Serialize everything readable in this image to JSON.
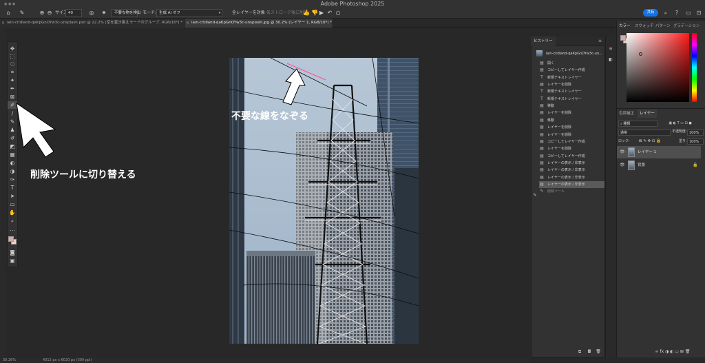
{
  "app": {
    "title": "Adobe Photoshop 2025"
  },
  "options_bar": {
    "size_label": "サイズ:",
    "size_value": "40",
    "detect_button": "不要な物を検出",
    "mode_label": "モード:",
    "mode_value": "生成 AI オフ",
    "all_layers_label": "全レイヤーを対象",
    "stroke_label": "各ストローク後に削除",
    "share_label": "共有"
  },
  "tabs": [
    {
      "label": "iain-cridland-qaKpGnOYw3c-unsplash.psd @ 22.2% (空を置き換えモードのグループ, RGB/16*) *"
    },
    {
      "label": "iain-cridland-qaKpGnOYw3c-unsplash.jpg @ 30.2% (レイヤー 1, RGB/16*) *"
    }
  ],
  "annotations": {
    "arrow_top_text": "不要な線をなぞる",
    "arrow_left_text": "削除ツールに切り替える"
  },
  "history": {
    "tab_label": "ヒストリー",
    "snapshot": "iain-cridland-qaKpGnOYw3c-un...",
    "items": [
      {
        "label": "開く",
        "icon": "doc-icon"
      },
      {
        "label": "コピーしてレイヤー作成",
        "icon": "doc-icon"
      },
      {
        "label": "新規テキストレイヤー",
        "icon": "text-icon"
      },
      {
        "label": "レイヤーを削除",
        "icon": "doc-icon"
      },
      {
        "label": "新規テキストレイヤー",
        "icon": "text-icon"
      },
      {
        "label": "新規テキストレイヤー",
        "icon": "text-icon"
      },
      {
        "label": "移動",
        "icon": "doc-icon"
      },
      {
        "label": "レイヤーを削除",
        "icon": "doc-icon"
      },
      {
        "label": "移動",
        "icon": "doc-icon"
      },
      {
        "label": "レイヤーを削除",
        "icon": "doc-icon"
      },
      {
        "label": "レイヤーを削除",
        "icon": "doc-icon"
      },
      {
        "label": "コピーしてレイヤー作成",
        "icon": "doc-icon"
      },
      {
        "label": "レイヤーを削除",
        "icon": "doc-icon"
      },
      {
        "label": "コピーしてレイヤー作成",
        "icon": "doc-icon"
      },
      {
        "label": "レイヤーの表示 / 非表示",
        "icon": "doc-icon"
      },
      {
        "label": "レイヤーの表示 / 非表示",
        "icon": "doc-icon"
      },
      {
        "label": "レイヤーの表示 / 非表示",
        "icon": "doc-icon"
      },
      {
        "label": "レイヤーの表示 / 非表示",
        "icon": "doc-icon"
      },
      {
        "label": "削除ツール",
        "icon": "brush-icon"
      }
    ]
  },
  "color_panel": {
    "tabs": [
      "カラー",
      "スウォッチ",
      "パターン",
      "グラデーション"
    ]
  },
  "layers_panel": {
    "tabs": [
      "色調補正",
      "レイヤー"
    ],
    "kind_label": "種類",
    "blend_mode": "通常",
    "opacity_label": "不透明度:",
    "opacity_value": "100%",
    "lock_label": "ロック:",
    "fill_label": "塗り:",
    "fill_value": "100%",
    "layers": [
      {
        "name": "レイヤー 1",
        "selected": true
      },
      {
        "name": "背景",
        "selected": false
      }
    ]
  },
  "status_bar": {
    "zoom": "30.26%",
    "doc_size": "4012 px x 6020 px (300 ppi)"
  },
  "colors": {
    "accent": "#1473e6",
    "foreground_swatch": "#d9a9a4",
    "background_swatch": "#e8d2cc"
  }
}
